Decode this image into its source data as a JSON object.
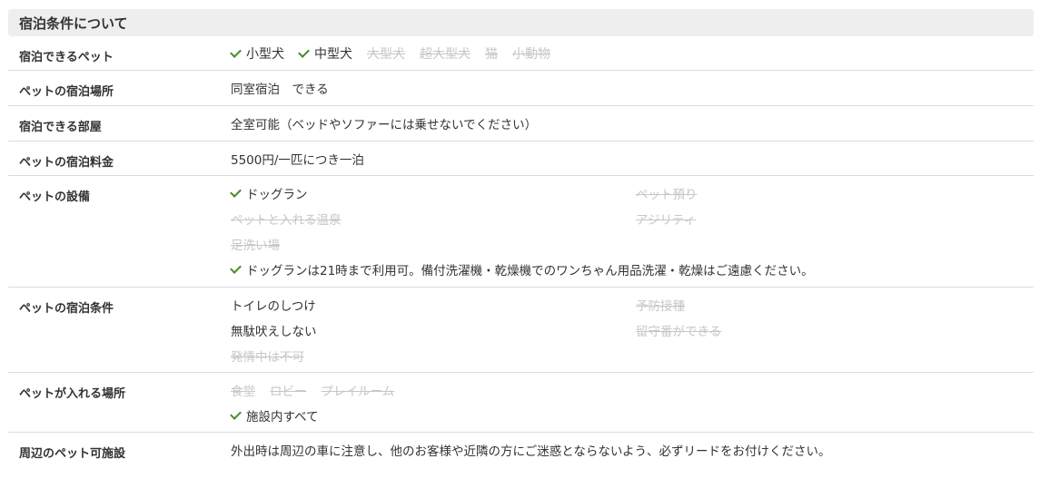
{
  "section_title": "宿泊条件について",
  "colors": {
    "check": "#4a8a2a",
    "disabled": "#c7c7c7",
    "header_bg": "#eeeeee"
  },
  "rows": {
    "pets": {
      "label": "宿泊できるペット",
      "items": [
        {
          "text": "小型犬",
          "available": true
        },
        {
          "text": "中型犬",
          "available": true
        },
        {
          "text": "大型犬",
          "available": false
        },
        {
          "text": "超大型犬",
          "available": false
        },
        {
          "text": "猫",
          "available": false
        },
        {
          "text": "小動物",
          "available": false
        }
      ]
    },
    "place": {
      "label": "ペットの宿泊場所",
      "value": "同室宿泊　できる"
    },
    "rooms": {
      "label": "宿泊できる部屋",
      "value": "全室可能（ベッドやソファーには乗せないでください）"
    },
    "fee": {
      "label": "ペットの宿泊料金",
      "value": "5500円/一匹につき一泊"
    },
    "facilities": {
      "label": "ペットの設備",
      "items": [
        {
          "text": "ドッグラン",
          "available": true
        },
        {
          "text": "ペット預り",
          "available": false
        },
        {
          "text": "ペットと入れる温泉",
          "available": false
        },
        {
          "text": "アジリティ",
          "available": false
        },
        {
          "text": "足洗い場",
          "available": false
        }
      ],
      "note": "ドッグランは21時まで利用可。備付洗濯機・乾燥機でのワンちゃん用品洗濯・乾燥はご遠慮ください。"
    },
    "conditions": {
      "label": "ペットの宿泊条件",
      "items": [
        {
          "text": "トイレのしつけ",
          "available": true
        },
        {
          "text": "予防接種",
          "available": false
        },
        {
          "text": "無駄吠えしない",
          "available": true
        },
        {
          "text": "留守番ができる",
          "available": false
        },
        {
          "text": "発情中は不可",
          "available": false
        }
      ]
    },
    "areas": {
      "label": "ペットが入れる場所",
      "items": [
        {
          "text": "食堂",
          "available": false
        },
        {
          "text": "ロビー",
          "available": false
        },
        {
          "text": "プレイルーム",
          "available": false
        }
      ],
      "all": "施設内すべて"
    },
    "nearby": {
      "label": "周辺のペット可施設",
      "value": "外出時は周辺の車に注意し、他のお客様や近隣の方にご迷惑とならないよう、必ずリードをお付けください。"
    }
  }
}
